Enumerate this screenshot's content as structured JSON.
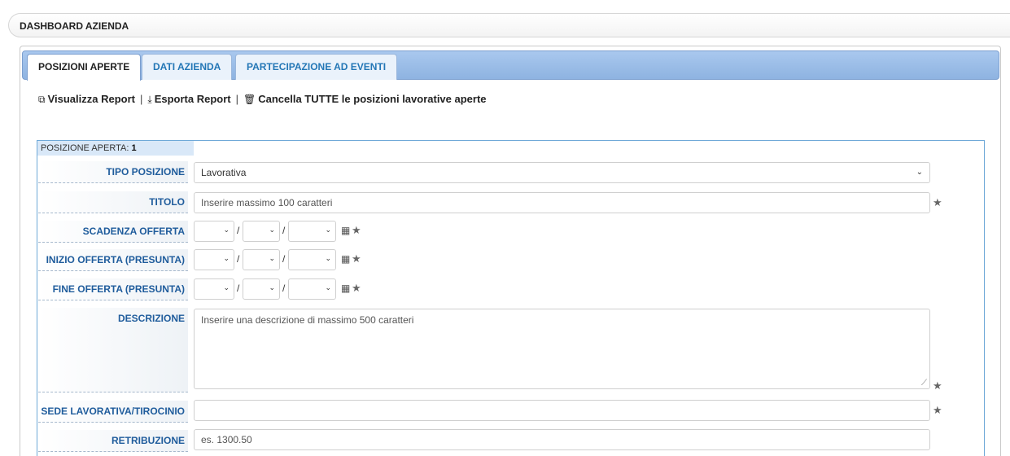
{
  "header": {
    "title": "DASHBOARD AZIENDA"
  },
  "tabs": [
    {
      "label": "POSIZIONI APERTE",
      "active": true
    },
    {
      "label": "DATI AZIENDA",
      "active": false
    },
    {
      "label": "PARTECIPAZIONE AD EVENTI",
      "active": false
    }
  ],
  "actions": {
    "view_icon": "view-report-icon",
    "view_label": "Visualizza Report",
    "export_icon": "download-icon",
    "export_label": "Esporta Report",
    "delete_icon": "trash-icon",
    "delete_label": "Cancella TUTTE le posizioni lavorative aperte",
    "separator": "|"
  },
  "form": {
    "caption_prefix": "POSIZIONE APERTA:",
    "caption_number": "1",
    "tipo_label": "TIPO POSIZIONE",
    "tipo_value": "Lavorativa",
    "titolo_label": "TITOLO",
    "titolo_placeholder": "Inserire massimo 100 caratteri",
    "scadenza_label": "SCADENZA OFFERTA",
    "inizio_label": "INIZIO OFFERTA (PRESUNTA)",
    "fine_label": "FINE OFFERTA (PRESUNTA)",
    "date_separator": "/",
    "descrizione_label": "DESCRIZIONE",
    "descrizione_placeholder": "Inserire una descrizione di massimo 500 caratteri",
    "sede_label": "SEDE LAVORATIVA/TIROCINIO",
    "sede_value": "",
    "retribuzione_label": "RETRIBUZIONE",
    "retribuzione_placeholder": "es. 1300.50"
  },
  "icons": {
    "required": "star-icon",
    "calendar": "calendar-icon",
    "dropdown": "chevron-down-icon"
  },
  "colors": {
    "tab_bar": "#9dbfe9",
    "label_text": "#1f5c9c",
    "tab_text": "#2477b6",
    "form_border": "#6fa9d8",
    "caption_bg": "#d9e8f8"
  }
}
